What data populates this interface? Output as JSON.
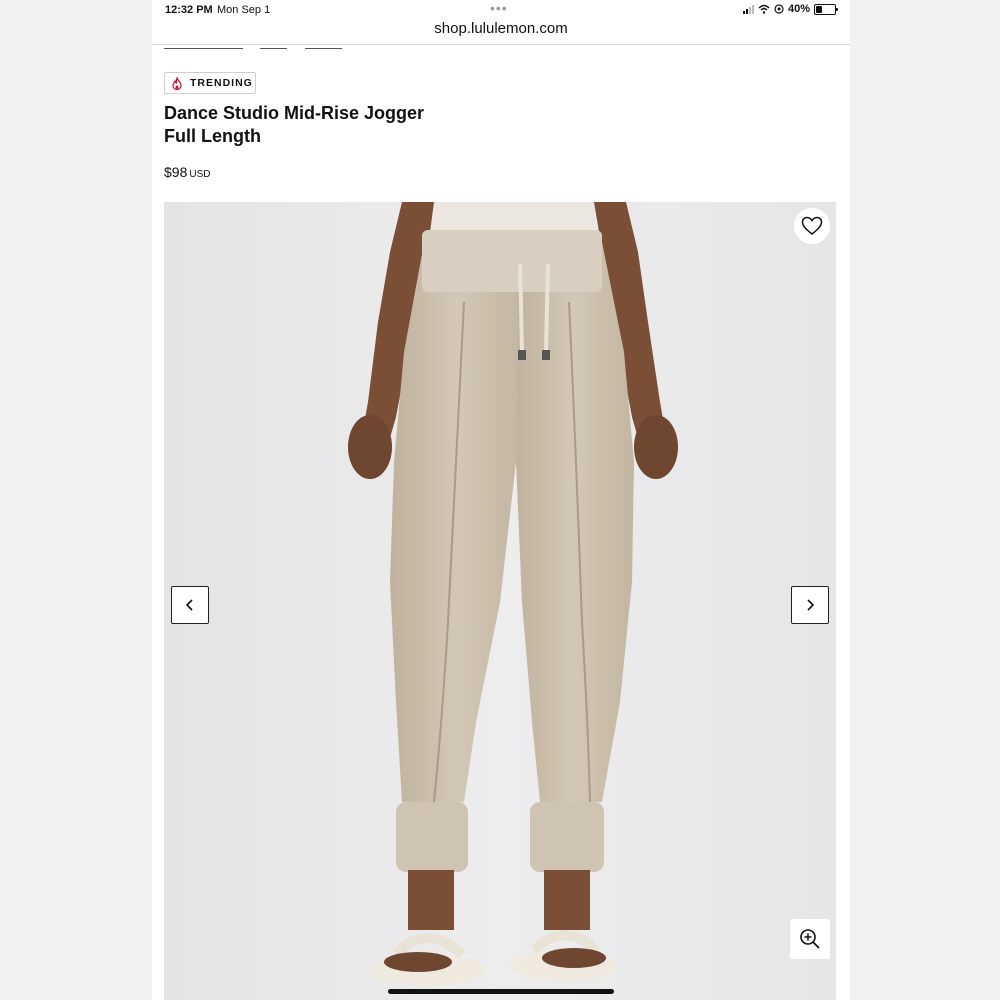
{
  "status_bar": {
    "time": "12:32 PM",
    "date": "Mon Sep 1",
    "battery": "40%",
    "battery_level": 0.4
  },
  "browser": {
    "url": "shop.lululemon.com"
  },
  "product": {
    "badge": "TRENDING",
    "title_line1": "Dance Studio Mid-Rise Jogger",
    "title_line2": "Full Length",
    "price": "$98",
    "currency": "USD"
  },
  "icons": {
    "badge": "flame-icon",
    "wishlist": "heart-icon",
    "prev": "chevron-left-icon",
    "next": "chevron-right-icon",
    "zoom": "zoom-in-icon"
  },
  "colors": {
    "accent_badge": "#c8102e",
    "pants": "#cbbfab",
    "background": "#e9e9eb"
  }
}
